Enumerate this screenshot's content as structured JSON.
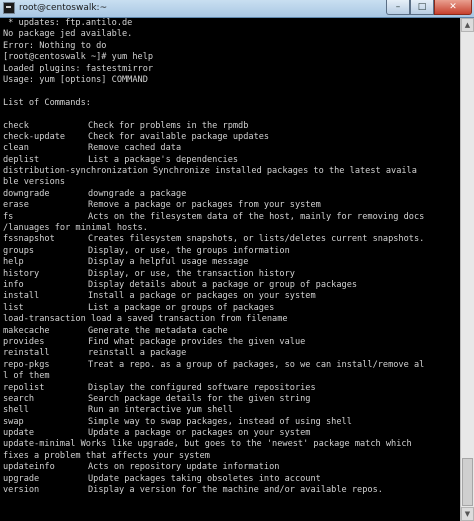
{
  "window": {
    "title": "root@centoswalk:~",
    "controls": {
      "minimize": "–",
      "maximize": "□",
      "close": "✕"
    }
  },
  "terminal": {
    "lines_before": [
      " * updates: ftp.antilo.de",
      "No package jed available.",
      "Error: Nothing to do",
      "[root@centoswalk ~]# yum help",
      "Loaded plugins: fastestmirror",
      "Usage: yum [options] COMMAND",
      "",
      "List of Commands:",
      ""
    ],
    "commands": [
      {
        "name": "check",
        "desc": "Check for problems in the rpmdb"
      },
      {
        "name": "check-update",
        "desc": "Check for available package updates"
      },
      {
        "name": "clean",
        "desc": "Remove cached data"
      },
      {
        "name": "deplist",
        "desc": "List a package's dependencies"
      },
      {
        "raw": "distribution-synchronization Synchronize installed packages to the latest availa"
      },
      {
        "raw": "ble versions"
      },
      {
        "name": "downgrade",
        "desc": "downgrade a package"
      },
      {
        "name": "erase",
        "desc": "Remove a package or packages from your system"
      },
      {
        "name": "fs",
        "desc": "Acts on the filesystem data of the host, mainly for removing docs"
      },
      {
        "raw": "/lanuages for minimal hosts."
      },
      {
        "name": "fssnapshot",
        "desc": "Creates filesystem snapshots, or lists/deletes current snapshots."
      },
      {
        "name": "groups",
        "desc": "Display, or use, the groups information"
      },
      {
        "name": "help",
        "desc": "Display a helpful usage message"
      },
      {
        "name": "history",
        "desc": "Display, or use, the transaction history"
      },
      {
        "name": "info",
        "desc": "Display details about a package or group of packages"
      },
      {
        "name": "install",
        "desc": "Install a package or packages on your system"
      },
      {
        "name": "list",
        "desc": "List a package or groups of packages"
      },
      {
        "raw": "load-transaction load a saved transaction from filename"
      },
      {
        "name": "makecache",
        "desc": "Generate the metadata cache"
      },
      {
        "name": "provides",
        "desc": "Find what package provides the given value"
      },
      {
        "name": "reinstall",
        "desc": "reinstall a package"
      },
      {
        "name": "repo-pkgs",
        "desc": "Treat a repo. as a group of packages, so we can install/remove al"
      },
      {
        "raw": "l of them"
      },
      {
        "name": "repolist",
        "desc": "Display the configured software repositories"
      },
      {
        "name": "search",
        "desc": "Search package details for the given string"
      },
      {
        "name": "shell",
        "desc": "Run an interactive yum shell"
      },
      {
        "name": "swap",
        "desc": "Simple way to swap packages, instead of using shell"
      },
      {
        "name": "update",
        "desc": "Update a package or packages on your system"
      },
      {
        "raw": "update-minimal Works like upgrade, but goes to the 'newest' package match which"
      },
      {
        "raw": "fixes a problem that affects your system"
      },
      {
        "name": "updateinfo",
        "desc": "Acts on repository update information"
      },
      {
        "name": "upgrade",
        "desc": "Update packages taking obsoletes into account"
      },
      {
        "name": "version",
        "desc": "Display a version for the machine and/or available repos."
      }
    ]
  },
  "scrollbar": {
    "up_icon": "▲",
    "down_icon": "▼"
  }
}
